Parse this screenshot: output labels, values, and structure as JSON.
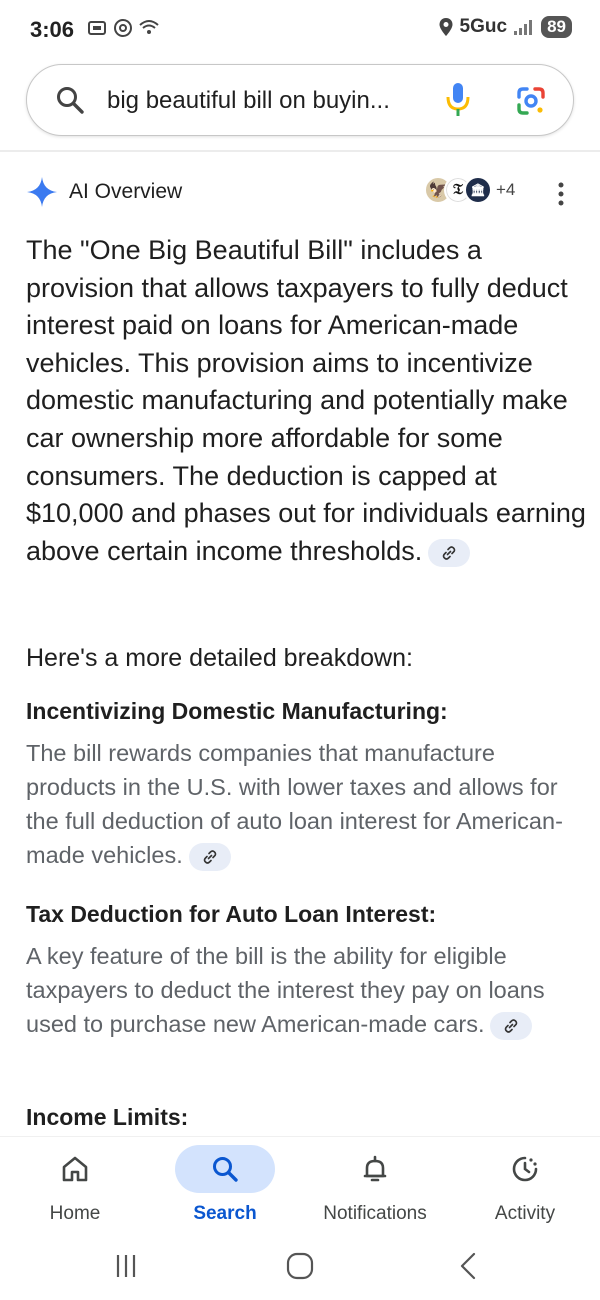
{
  "status_bar": {
    "time": "3:06",
    "network": "5Guc",
    "battery": "89"
  },
  "search": {
    "query": "big beautiful bill on buyin..."
  },
  "ai_overview": {
    "title": "AI Overview",
    "sources_more": "+4",
    "summary": "The \"One Big Beautiful Bill\" includes a provision that allows taxpayers to fully deduct interest paid on loans for American-made vehicles. This provision aims to incentivize domestic manufacturing and potentially make car ownership more affordable for some consumers. The deduction is capped at $10,000 and phases out for individuals earning above certain income thresholds.",
    "breakdown_title": "Here's a more detailed breakdown:",
    "sections": [
      {
        "heading": "Incentivizing Domestic Manufacturing:",
        "body": "The bill rewards companies that manufacture products in the U.S. with lower taxes and allows for the full deduction of auto loan interest for American-made vehicles."
      },
      {
        "heading": "Tax Deduction for Auto Loan Interest:",
        "body": "A key feature of the bill is the ability for eligible taxpayers to deduct the interest they pay on loans used to purchase new American-made cars."
      },
      {
        "heading": "Income Limits:",
        "body": ""
      }
    ]
  },
  "bottom_nav": {
    "items": [
      {
        "label": "Home",
        "icon": "home-icon"
      },
      {
        "label": "Search",
        "icon": "search-icon",
        "active": true
      },
      {
        "label": "Notifications",
        "icon": "bell-icon"
      },
      {
        "label": "Activity",
        "icon": "activity-icon"
      }
    ]
  },
  "colors": {
    "accent": "#0b57d0",
    "active_pill": "#d3e3fd",
    "secondary_text": "#5f6368",
    "link_chip": "#e8edf7"
  }
}
